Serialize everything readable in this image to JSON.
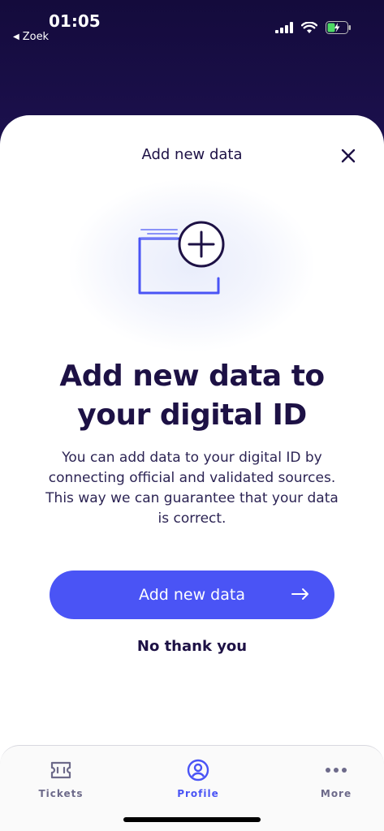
{
  "status_bar": {
    "time": "01:05",
    "back_label": "Zoek",
    "icons": [
      "signal-icon",
      "wifi-icon",
      "battery-charging-icon"
    ]
  },
  "sheet": {
    "title": "Add new data",
    "close_icon": "close-icon",
    "illustration_icon": "folder-add-icon",
    "headline": "Add new data to your digital ID",
    "description": "You can add data to your digital ID by connecting official and validated sources. This way we can guarantee that your data is correct.",
    "primary_button": "Add new data",
    "secondary_button": "No thank you"
  },
  "tab_bar": {
    "tabs": [
      {
        "label": "Tickets",
        "icon": "ticket-icon",
        "active": false
      },
      {
        "label": "Profile",
        "icon": "profile-icon",
        "active": true
      },
      {
        "label": "More",
        "icon": "more-icon",
        "active": false
      }
    ]
  },
  "colors": {
    "header_bg": "#1a0f4a",
    "accent": "#4a54f5",
    "text_dark": "#1d1145",
    "tab_inactive": "#6d6a8a"
  }
}
